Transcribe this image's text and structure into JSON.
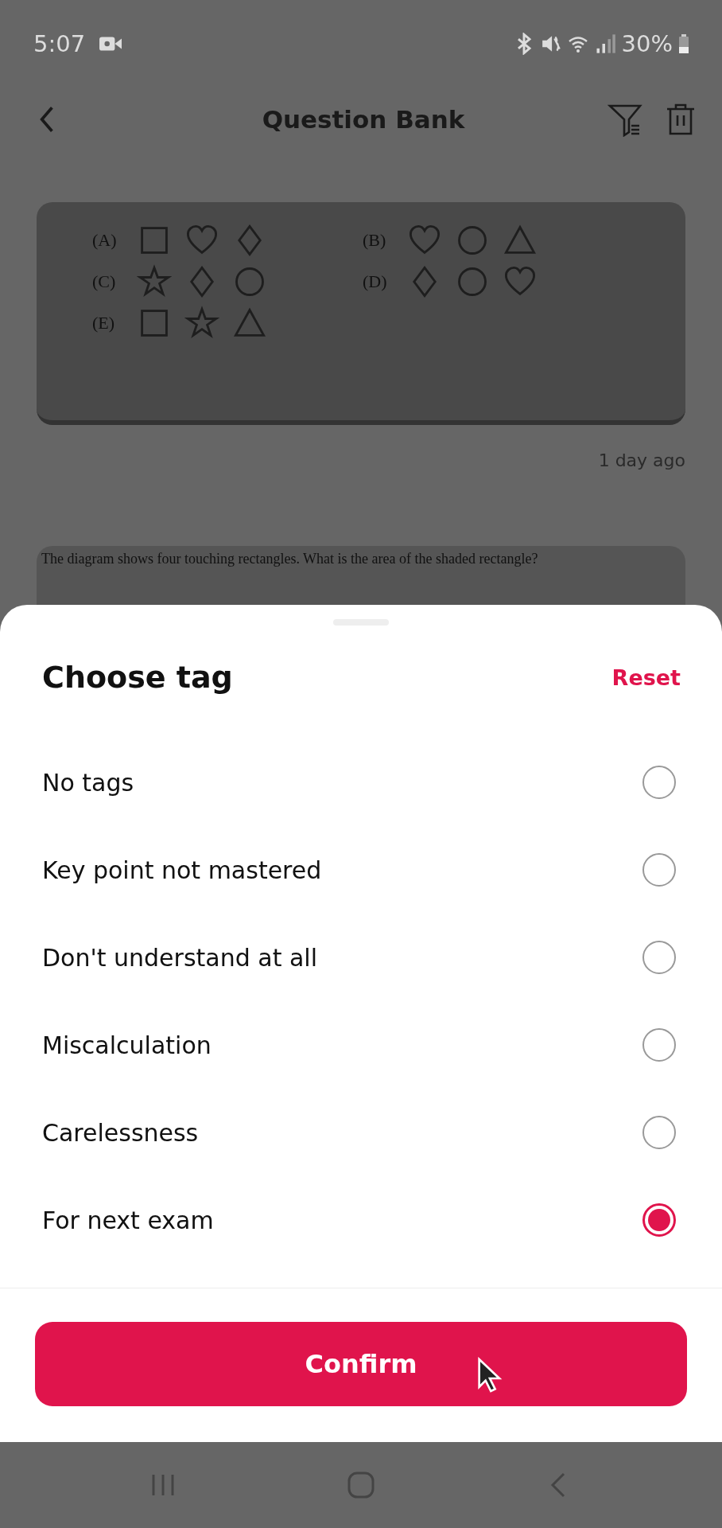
{
  "status_bar": {
    "time": "5:07",
    "battery": "30%"
  },
  "header": {
    "title": "Question Bank"
  },
  "questions": [
    {
      "kind": "figure",
      "options": [
        {
          "label": "(A)",
          "shapes": [
            {
              "kind": "square"
            },
            {
              "kind": "heart"
            },
            {
              "kind": "diamond"
            }
          ]
        },
        {
          "label": "(B)",
          "shapes": [
            {
              "kind": "heart"
            },
            {
              "kind": "circle"
            },
            {
              "kind": "triangle"
            }
          ]
        },
        {
          "label": "(C)",
          "shapes": [
            {
              "kind": "star"
            },
            {
              "kind": "diamond"
            },
            {
              "kind": "circle"
            }
          ]
        },
        {
          "label": "(D)",
          "shapes": [
            {
              "kind": "diamond"
            },
            {
              "kind": "circle"
            },
            {
              "kind": "heart"
            }
          ]
        },
        {
          "label": "(E)",
          "shapes": [
            {
              "kind": "square"
            },
            {
              "kind": "star"
            },
            {
              "kind": "triangle"
            }
          ]
        }
      ],
      "time": "1 day ago"
    },
    {
      "kind": "text",
      "text": "The diagram shows four touching rectangles. What is the area of the shaded rectangle?"
    }
  ],
  "sheet": {
    "title": "Choose tag",
    "reset": "Reset",
    "tags": [
      {
        "label": "No tags",
        "selected": false
      },
      {
        "label": "Key point not mastered",
        "selected": false
      },
      {
        "label": "Don't understand at all",
        "selected": false
      },
      {
        "label": "Miscalculation",
        "selected": false
      },
      {
        "label": "Carelessness",
        "selected": false
      },
      {
        "label": "For next exam",
        "selected": true
      }
    ],
    "confirm": "Confirm"
  }
}
